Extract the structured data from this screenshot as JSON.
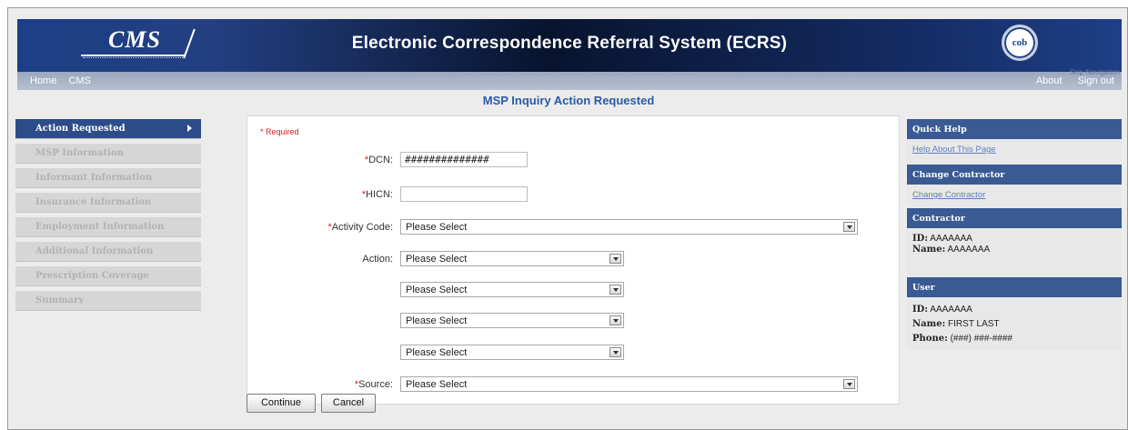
{
  "header": {
    "logo_text": "CMS",
    "title": "Electronic Correspondence Referral System (ECRS)",
    "cob_logo_text": "cob"
  },
  "nav": {
    "left": [
      "Home",
      "CMS"
    ],
    "right": [
      "About",
      "Sign out"
    ],
    "skip": "Skip Navigation"
  },
  "page_title": "MSP Inquiry Action Requested",
  "sidebar": {
    "items": [
      {
        "label": "Action Requested",
        "active": true
      },
      {
        "label": "MSP Information",
        "active": false
      },
      {
        "label": "Informant Information",
        "active": false
      },
      {
        "label": "Insurance Information",
        "active": false
      },
      {
        "label": "Employment Information",
        "active": false
      },
      {
        "label": "Additional Information",
        "active": false
      },
      {
        "label": "Prescription Coverage",
        "active": false
      },
      {
        "label": "Summary",
        "active": false
      }
    ]
  },
  "form": {
    "required_note": "* Required",
    "dcn": {
      "label": "DCN:",
      "value": "##############"
    },
    "hicn": {
      "label": "HICN:",
      "value": ""
    },
    "activity_code": {
      "label": "Activity Code:",
      "value": "Please Select"
    },
    "action": {
      "label": "Action:",
      "values": [
        "Please Select",
        "Please Select",
        "Please Select",
        "Please Select"
      ]
    },
    "source": {
      "label": "Source:",
      "value": "Please Select"
    },
    "required_marker": "*",
    "continue_label": "Continue",
    "cancel_label": "Cancel"
  },
  "right_panel": {
    "quick_help": {
      "title": "Quick Help",
      "link": "Help About This Page"
    },
    "change_contractor": {
      "title": "Change Contractor",
      "link": "Change Contractor"
    },
    "contractor": {
      "title": "Contractor",
      "id_label": "ID:",
      "id_value": "AAAAAAA",
      "name_label": "Name:",
      "name_value": "AAAAAAA"
    },
    "user": {
      "title": "User",
      "id_label": "ID:",
      "id_value": "AAAAAAA",
      "name_label": "Name:",
      "name_value": "FIRST LAST",
      "phone_label": "Phone:",
      "phone_value": "(###) ###-####"
    }
  }
}
